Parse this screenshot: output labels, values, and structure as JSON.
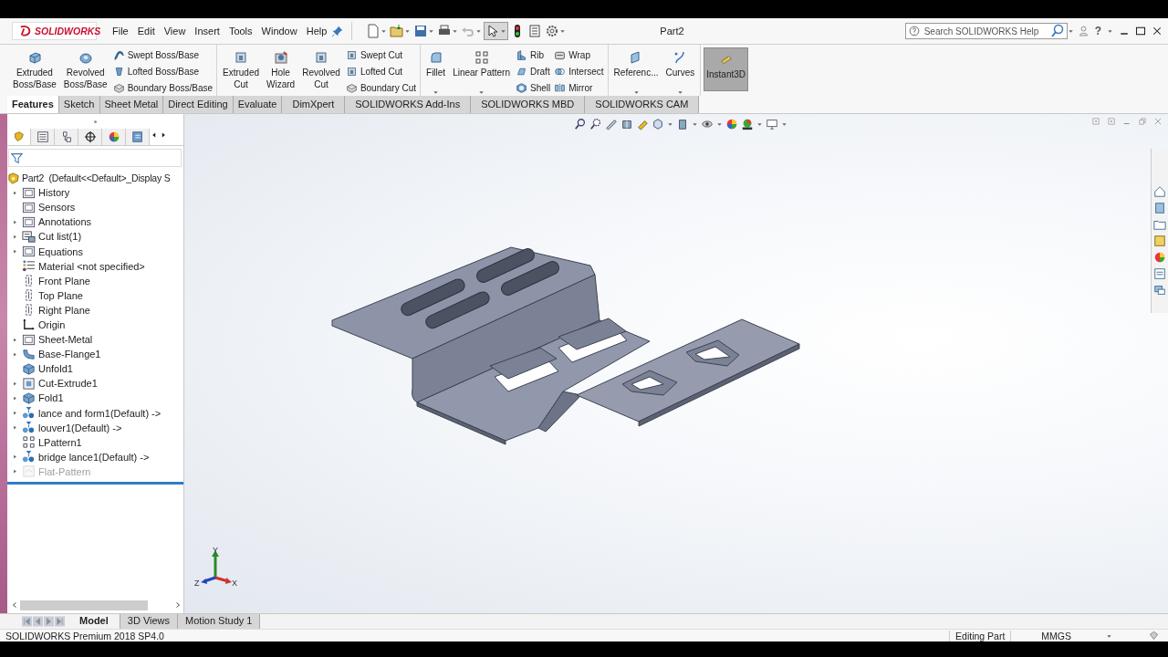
{
  "titlebar": {
    "logo": "SOLIDWORKS",
    "menu": [
      "File",
      "Edit",
      "View",
      "Insert",
      "Tools",
      "Window",
      "Help"
    ],
    "document_title": "Part2",
    "search": {
      "placeholder": "Search SOLIDWORKS Help"
    },
    "help": "?"
  },
  "ribbon": {
    "groups": [
      {
        "items": [
          {
            "kind": "big",
            "label": "Extruded\nBoss/Base"
          },
          {
            "kind": "big",
            "label": "Revolved\nBoss/Base"
          },
          {
            "kind": "column",
            "entries": [
              {
                "label": "Swept Boss/Base"
              },
              {
                "label": "Lofted Boss/Base"
              },
              {
                "label": "Boundary Boss/Base"
              }
            ]
          }
        ]
      },
      {
        "items": [
          {
            "kind": "big",
            "label": "Extruded\nCut"
          },
          {
            "kind": "big",
            "label": "Hole\nWizard"
          },
          {
            "kind": "big",
            "label": "Revolved\nCut"
          },
          {
            "kind": "column",
            "entries": [
              {
                "label": "Swept Cut"
              },
              {
                "label": "Lofted Cut"
              },
              {
                "label": "Boundary Cut"
              }
            ]
          }
        ]
      },
      {
        "items": [
          {
            "kind": "dropdown",
            "label": "Fillet"
          },
          {
            "kind": "dropdown",
            "label": "Linear Pattern"
          },
          {
            "kind": "column",
            "entries": [
              {
                "label": "Rib"
              },
              {
                "label": "Draft"
              },
              {
                "label": "Shell"
              }
            ]
          },
          {
            "kind": "column",
            "entries": [
              {
                "label": "Wrap"
              },
              {
                "label": "Intersect"
              },
              {
                "label": "Mirror"
              }
            ]
          }
        ]
      },
      {
        "items": [
          {
            "kind": "dropdown",
            "label": "Referenc..."
          },
          {
            "kind": "dropdown",
            "label": "Curves"
          }
        ]
      },
      {
        "items": [
          {
            "kind": "toggle",
            "label": "Instant3D",
            "on": true
          }
        ]
      }
    ]
  },
  "command_tabs": [
    {
      "label": "Features",
      "selected": true
    },
    {
      "label": "Sketch",
      "selected": false
    },
    {
      "label": "Sheet Metal",
      "selected": false
    },
    {
      "label": "Direct Editing",
      "selected": false
    },
    {
      "label": "Evaluate",
      "selected": false
    },
    {
      "label": "DimXpert",
      "selected": false
    },
    {
      "label": "SOLIDWORKS Add-Ins",
      "selected": false
    },
    {
      "label": "SOLIDWORKS MBD",
      "selected": false
    },
    {
      "label": "SOLIDWORKS CAM",
      "selected": false
    }
  ],
  "panel_tabs": [
    {
      "selected": true
    },
    {
      "selected": false
    },
    {
      "selected": false
    },
    {
      "selected": false
    },
    {
      "selected": false
    },
    {
      "selected": false
    }
  ],
  "tree": {
    "root": "Part2  (Default<<Default>_Display S",
    "items": [
      {
        "label": "History",
        "kind": "folder",
        "expandable": true,
        "disabled": false
      },
      {
        "label": "Sensors",
        "kind": "folder",
        "expandable": false,
        "disabled": false
      },
      {
        "label": "Annotations",
        "kind": "folder",
        "expandable": true,
        "disabled": false
      },
      {
        "label": "Cut list(1)",
        "kind": "cutlist",
        "expandable": true,
        "disabled": false
      },
      {
        "label": "Equations",
        "kind": "folder",
        "expandable": true,
        "disabled": false
      },
      {
        "label": "Material <not specified>",
        "kind": "material",
        "expandable": false,
        "disabled": false
      },
      {
        "label": "Front Plane",
        "kind": "plane",
        "expandable": false,
        "disabled": false
      },
      {
        "label": "Top Plane",
        "kind": "plane",
        "expandable": false,
        "disabled": false
      },
      {
        "label": "Right Plane",
        "kind": "plane",
        "expandable": false,
        "disabled": false
      },
      {
        "label": "Origin",
        "kind": "origin",
        "expandable": false,
        "disabled": false
      },
      {
        "label": "Sheet-Metal",
        "kind": "folder",
        "expandable": true,
        "disabled": false
      },
      {
        "label": "Base-Flange1",
        "kind": "flange",
        "expandable": true,
        "disabled": false
      },
      {
        "label": "Unfold1",
        "kind": "feature",
        "expandable": false,
        "disabled": false
      },
      {
        "label": "Cut-Extrude1",
        "kind": "cut",
        "expandable": true,
        "disabled": false
      },
      {
        "label": "Fold1",
        "kind": "feature",
        "expandable": true,
        "disabled": false
      },
      {
        "label": "lance and form1(Default) ->",
        "kind": "library",
        "expandable": true,
        "disabled": false
      },
      {
        "label": "louver1(Default) ->",
        "kind": "library",
        "expandable": true,
        "disabled": false
      },
      {
        "label": "LPattern1",
        "kind": "pattern",
        "expandable": false,
        "disabled": false
      },
      {
        "label": "bridge lance1(Default) ->",
        "kind": "library",
        "expandable": true,
        "disabled": false
      },
      {
        "label": "Flat-Pattern",
        "kind": "flat",
        "expandable": true,
        "disabled": true
      }
    ]
  },
  "triad": {
    "y": "Y",
    "z": "Z",
    "x": "X"
  },
  "bottom_tabs": [
    {
      "label": "Model",
      "selected": true
    },
    {
      "label": "3D Views",
      "selected": false
    },
    {
      "label": "Motion Study 1",
      "selected": false
    }
  ],
  "status_bar": {
    "product": "SOLIDWORKS Premium 2018 SP4.0",
    "mode": "Editing Part",
    "units": "MMGS"
  }
}
